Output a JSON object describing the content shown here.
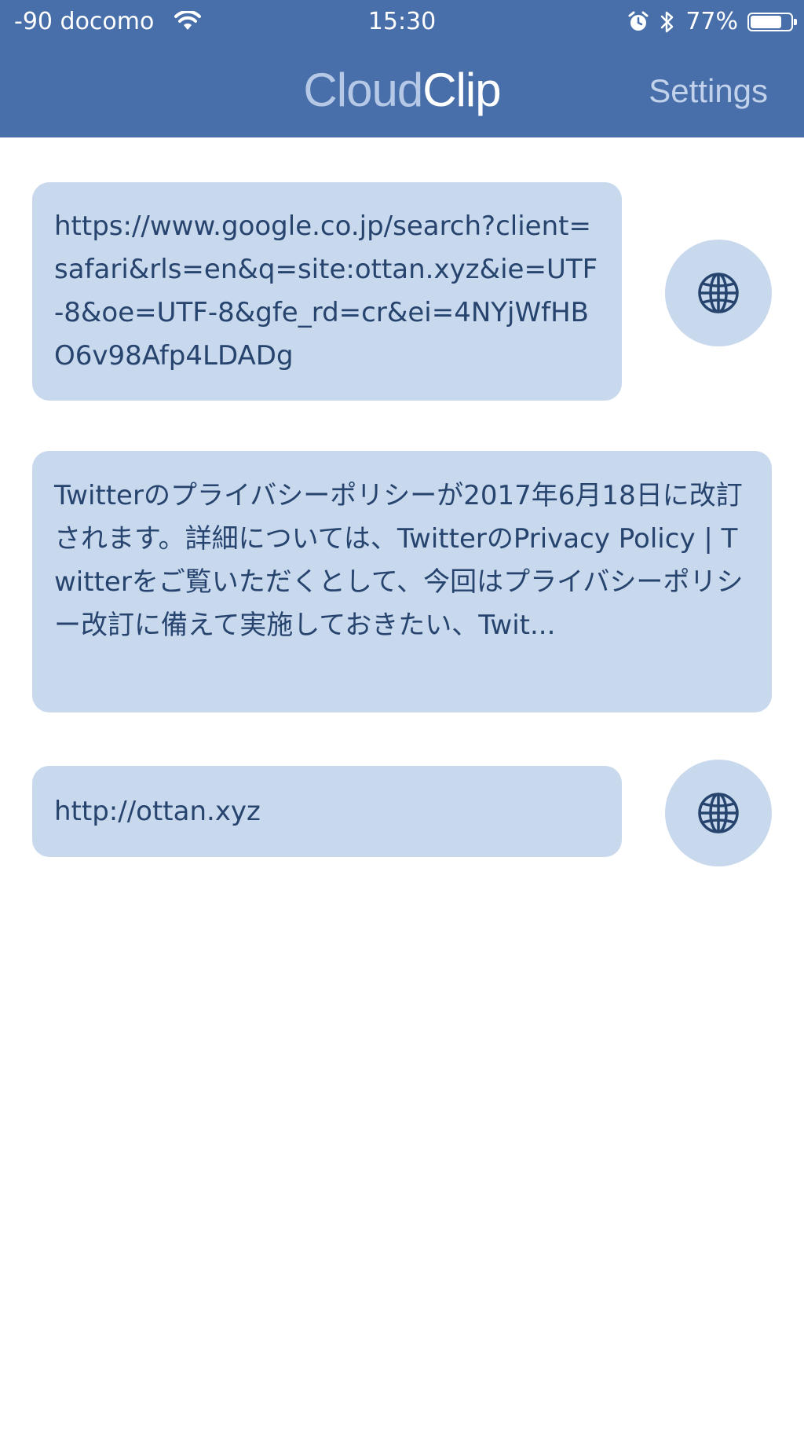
{
  "status_bar": {
    "carrier": "-90 docomo",
    "time": "15:30",
    "battery_percent": "77%",
    "battery_level": 0.77,
    "icons": [
      "wifi-icon",
      "alarm-icon",
      "bluetooth-icon",
      "battery-icon"
    ]
  },
  "nav": {
    "title_part1": "Cloud",
    "title_part2": "Clip",
    "settings_label": "Settings"
  },
  "clips": [
    {
      "text": "https://www.google.co.jp/search?client=safari&rls=en&q=site:ottan.xyz&ie=UTF-8&oe=UTF-8&gfe_rd=cr&ei=4NYjWfHBO6v98Afp4LDADg",
      "has_open_button": true
    },
    {
      "text": "Twitterのプライバシーポリシーが2017年6月18日に改訂されます。詳細については、TwitterのPrivacy Policy | Twitterをご覧いただくとして、今回はプライバシーポリシー改訂に備えて実施しておきたい、Twit...",
      "has_open_button": false
    },
    {
      "text": "http://ottan.xyz",
      "has_open_button": true
    }
  ],
  "colors": {
    "header_bg": "#486fa9",
    "clip_bg": "#c8d8ed",
    "clip_text": "#26446e",
    "title_light": "#b5c8e6"
  }
}
